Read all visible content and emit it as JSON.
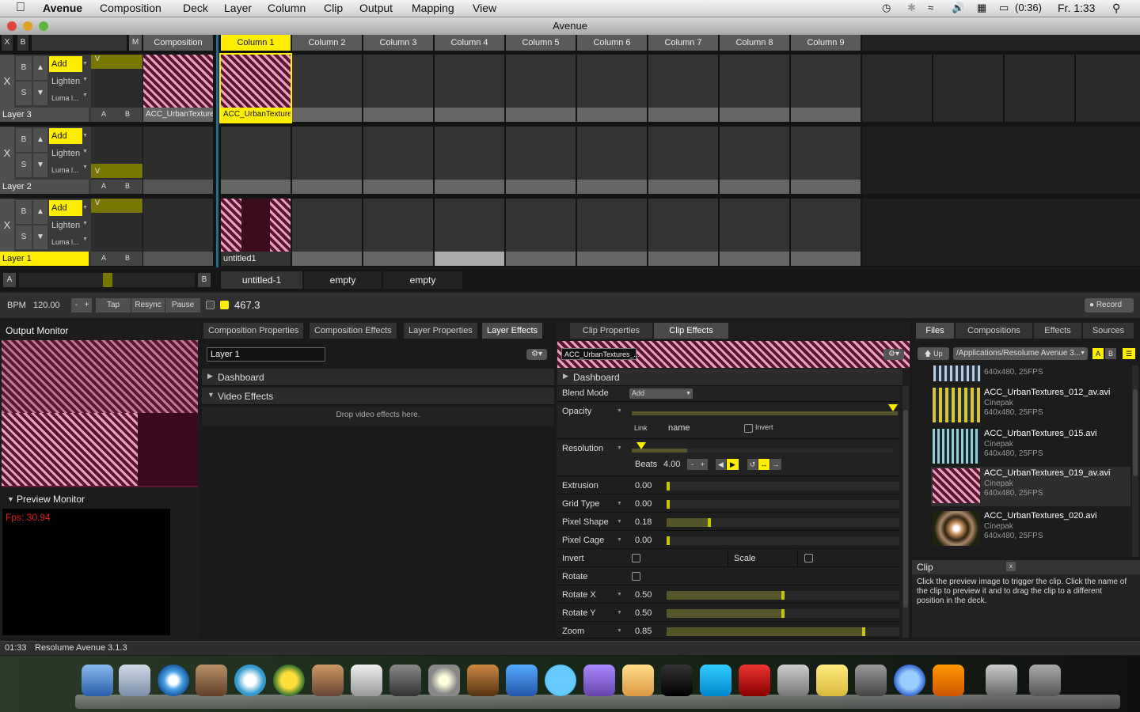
{
  "menubar": {
    "apple": "",
    "app": "Avenue",
    "items": [
      "Composition",
      "Deck",
      "Layer",
      "Column",
      "Clip",
      "Output",
      "Mapping",
      "View"
    ],
    "battery": "(0:36)",
    "clock": "Fr. 1:33"
  },
  "window": {
    "title": "Avenue"
  },
  "grid": {
    "x_label": "X",
    "b_label": "B",
    "m_label": "M",
    "composition_label": "Composition",
    "columns": [
      "Column 1",
      "Column 2",
      "Column 3",
      "Column 4",
      "Column 5",
      "Column 6",
      "Column 7",
      "Column 8",
      "Column 9"
    ],
    "layers": [
      {
        "name": "Layer 3",
        "blend_modes": [
          "Add",
          "Lighten",
          "Luma l..."
        ],
        "bypass": "B",
        "solo": "S",
        "x": "X",
        "a": "A",
        "b": "B",
        "v": "V",
        "clip1": "ACC_UrbanTexture...",
        "comp_clip": "ACC_UrbanTexture..."
      },
      {
        "name": "Layer 2",
        "blend_modes": [
          "Add",
          "Lighten",
          "Luma l..."
        ],
        "bypass": "B",
        "solo": "S",
        "x": "X",
        "a": "A",
        "b": "B",
        "v": "V"
      },
      {
        "name": "Layer 1",
        "blend_modes": [
          "Add",
          "Lighten",
          "Luma l..."
        ],
        "bypass": "B",
        "solo": "S",
        "x": "X",
        "a": "A",
        "b": "B",
        "v": "V",
        "clip1": "untitled1"
      }
    ]
  },
  "crossfader": {
    "a": "A",
    "b": "B",
    "decks": [
      "untitled-1",
      "empty",
      "empty"
    ]
  },
  "transport": {
    "bpm_label": "BPM",
    "bpm": "120.00",
    "minus": "-",
    "plus": "+",
    "tap": "Tap",
    "resync": "Resync",
    "pause": "Pause",
    "beat": "467.3",
    "record": "Record"
  },
  "output_monitor": {
    "title": "Output Monitor"
  },
  "preview_monitor": {
    "title": "Preview Monitor",
    "fps": "Fps: 30.94"
  },
  "layer_tabs": [
    "Composition Properties",
    "Composition Effects",
    "Layer Properties",
    "Layer Effects"
  ],
  "layer_panel": {
    "name": "Layer 1",
    "dashboard": "Dashboard",
    "video_effects": "Video Effects",
    "drop_hint": "Drop video effects here."
  },
  "clip_tabs": [
    "Clip Properties",
    "Clip Effects"
  ],
  "clip_panel": {
    "clip_name": "ACC_UrbanTextures_...",
    "dashboard": "Dashboard",
    "blend_mode_label": "Blend Mode",
    "blend_mode": "Add",
    "opacity_label": "Opacity",
    "opacity": 1.0,
    "link": "Link",
    "name": "name",
    "invert": "Invert",
    "resolution_label": "Resolution",
    "beats_label": "Beats",
    "beats": "4.00",
    "params": [
      {
        "label": "Extrusion",
        "value": "0.00",
        "level": 0.0
      },
      {
        "label": "Grid Type",
        "value": "0.00",
        "level": 0.0
      },
      {
        "label": "Pixel Shape",
        "value": "0.18",
        "level": 0.18
      },
      {
        "label": "Pixel Cage",
        "value": "0.00",
        "level": 0.0
      }
    ],
    "invert_label": "Invert",
    "scale_label": "Scale",
    "rotate_label": "Rotate",
    "params2": [
      {
        "label": "Rotate X",
        "value": "0.50",
        "level": 0.5
      },
      {
        "label": "Rotate Y",
        "value": "0.50",
        "level": 0.5
      },
      {
        "label": "Zoom",
        "value": "0.85",
        "level": 0.85
      }
    ]
  },
  "browser_tabs": [
    "Files",
    "Compositions",
    "Effects",
    "Sources"
  ],
  "browser": {
    "up": "Up",
    "path": "/Applications/Resolume Avenue 3...",
    "a": "A",
    "b": "B",
    "top_fragment": "640x480, 25FPS",
    "files": [
      {
        "name": "ACC_UrbanTextures_012_av.avi",
        "codec": "Cinepak",
        "info": "640x480, 25FPS"
      },
      {
        "name": "ACC_UrbanTextures_015.avi",
        "codec": "Cinepak",
        "info": "640x480, 25FPS"
      },
      {
        "name": "ACC_UrbanTextures_019_av.avi",
        "codec": "Cinepak",
        "info": "640x480, 25FPS"
      },
      {
        "name": "ACC_UrbanTextures_020.avi",
        "codec": "Cinepak",
        "info": "640x480, 25FPS"
      }
    ]
  },
  "help": {
    "title": "Clip",
    "close": "x",
    "text": "Click the preview image to trigger the clip. Click the name of the clip to preview it and to drag the clip to a different position in the deck."
  },
  "statusbar": {
    "time": "01:33",
    "app": "Resolume Avenue 3.1.3"
  },
  "colors": {
    "accent": "#ffee00",
    "olive": "#777700",
    "pink": "#c0507a"
  }
}
